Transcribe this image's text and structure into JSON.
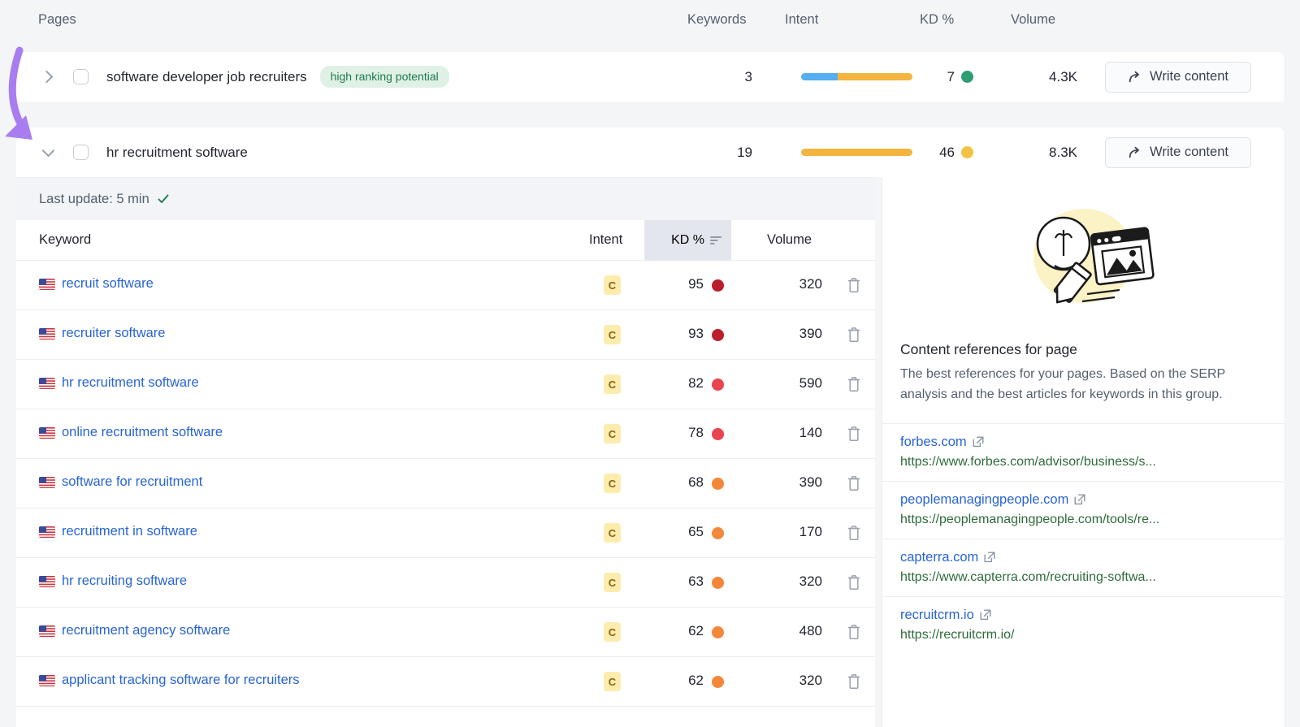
{
  "columns": {
    "pages": "Pages",
    "keywords": "Keywords",
    "intent": "Intent",
    "kd": "KD %",
    "volume": "Volume"
  },
  "colors": {
    "intent_commercial": "#f3b53f",
    "intent_informational": "#55aef0",
    "kd_easy": "#2f9e73",
    "kd_medium": "#f3c244",
    "kd_hard": "#e8434f",
    "kd_very_hard": "#bb1d2c",
    "kd_difficult": "#f5873a",
    "badge_green_bg": "#dff1e4",
    "badge_green_text": "#1f7a4d",
    "link_blue": "#2864d4",
    "url_green": "#2d6b3a",
    "annotation_purple": "#a77df0"
  },
  "page_rows": [
    {
      "title": "software developer job recruiters",
      "badge": "high ranking potential",
      "expanded": false,
      "checked": false,
      "keywords": "3",
      "intent_segments": [
        {
          "name": "informational",
          "color": "#55aef0",
          "percent": 33
        },
        {
          "name": "commercial",
          "color": "#f3b53f",
          "percent": 67
        }
      ],
      "kd": "7",
      "kd_color": "#2f9e73",
      "volume": "4.3K",
      "action": "Write content"
    },
    {
      "title": "hr recruitment software",
      "badge": null,
      "expanded": true,
      "checked": false,
      "keywords": "19",
      "intent_segments": [
        {
          "name": "commercial",
          "color": "#f3b53f",
          "percent": 100
        }
      ],
      "kd": "46",
      "kd_color": "#f3c244",
      "volume": "8.3K",
      "action": "Write content"
    }
  ],
  "detail": {
    "last_update": "Last update: 5 min",
    "table_headers": {
      "keyword": "Keyword",
      "intent": "Intent",
      "kd": "KD %",
      "volume": "Volume"
    },
    "sort_column": "KD %",
    "sort_direction": "descending",
    "rows": [
      {
        "country": "US",
        "keyword": "recruit software",
        "intent": "C",
        "kd": "95",
        "kd_color": "#bb1d2c",
        "volume": "320"
      },
      {
        "country": "US",
        "keyword": "recruiter software",
        "intent": "C",
        "kd": "93",
        "kd_color": "#bb1d2c",
        "volume": "390"
      },
      {
        "country": "US",
        "keyword": "hr recruitment software",
        "intent": "C",
        "kd": "82",
        "kd_color": "#e8434f",
        "volume": "590"
      },
      {
        "country": "US",
        "keyword": "online recruitment software",
        "intent": "C",
        "kd": "78",
        "kd_color": "#e8434f",
        "volume": "140"
      },
      {
        "country": "US",
        "keyword": "software for recruitment",
        "intent": "C",
        "kd": "68",
        "kd_color": "#f5873a",
        "volume": "390"
      },
      {
        "country": "US",
        "keyword": "recruitment in software",
        "intent": "C",
        "kd": "65",
        "kd_color": "#f5873a",
        "volume": "170"
      },
      {
        "country": "US",
        "keyword": "hr recruiting software",
        "intent": "C",
        "kd": "63",
        "kd_color": "#f5873a",
        "volume": "320"
      },
      {
        "country": "US",
        "keyword": "recruitment agency software",
        "intent": "C",
        "kd": "62",
        "kd_color": "#f5873a",
        "volume": "480"
      },
      {
        "country": "US",
        "keyword": "applicant tracking software for recruiters",
        "intent": "C",
        "kd": "62",
        "kd_color": "#f5873a",
        "volume": "320"
      }
    ]
  },
  "references": {
    "title": "Content references for page",
    "description": "The best references for your pages. Based on the SERP analysis and the best articles for keywords in this group.",
    "items": [
      {
        "domain": "forbes.com",
        "url": "https://www.forbes.com/advisor/business/s..."
      },
      {
        "domain": "peoplemanagingpeople.com",
        "url": "https://peoplemanagingpeople.com/tools/re..."
      },
      {
        "domain": "capterra.com",
        "url": "https://www.capterra.com/recruiting-softwa..."
      },
      {
        "domain": "recruitcrm.io",
        "url": "https://recruitcrm.io/"
      }
    ]
  }
}
